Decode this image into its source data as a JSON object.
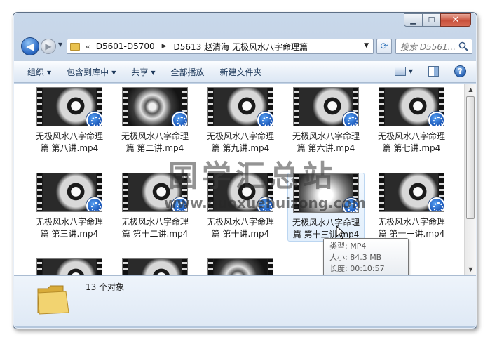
{
  "window": {
    "caption": {
      "minimize": "▁",
      "maximize": "☐",
      "close": "✕"
    }
  },
  "nav": {
    "back_glyph": "◀",
    "forward_glyph": "▶",
    "breadcrumb": [
      "D5601-D5700",
      "D5613 赵清海 无极风水八字命理篇"
    ],
    "breadcrumb_overflow": "«",
    "search_placeholder": "搜索 D5561..."
  },
  "toolbar": {
    "items": [
      "组织",
      "包含到库中",
      "共享",
      "全部播放",
      "新建文件夹"
    ],
    "has_dropdown": [
      true,
      true,
      true,
      false,
      false
    ]
  },
  "files": [
    {
      "name": "无极风水八字命理篇  第八讲.mp4",
      "thumb": "v1"
    },
    {
      "name": "无极风水八字命理篇  第二讲.mp4",
      "thumb": "v2"
    },
    {
      "name": "无极风水八字命理篇  第九讲.mp4",
      "thumb": "v1"
    },
    {
      "name": "无极风水八字命理篇  第六讲.mp4",
      "thumb": "v1"
    },
    {
      "name": "无极风水八字命理篇  第七讲.mp4",
      "thumb": "v1"
    },
    {
      "name": "无极风水八字命理篇  第三讲.mp4",
      "thumb": "v1"
    },
    {
      "name": "无极风水八字命理篇  第十二讲.mp4",
      "thumb": "v1"
    },
    {
      "name": "无极风水八字命理篇  第十讲.mp4",
      "thumb": "v1"
    },
    {
      "name": "无极风水八字命理篇  第十三讲.mp4",
      "thumb": "v3"
    },
    {
      "name": "无极风水八字命理篇  第十一讲.mp4",
      "thumb": "v1"
    },
    {
      "name": "",
      "thumb": "v1"
    },
    {
      "name": "",
      "thumb": "v1"
    },
    {
      "name": "",
      "thumb": "v2"
    }
  ],
  "tooltip": {
    "type": "类型: MP4",
    "size": "大小: 84.3 MB",
    "duration": "长度: 00:10:57"
  },
  "watermark": {
    "cn": "国学汇总站",
    "url": "www.guoxuehuizong.com"
  },
  "details": {
    "count_text": "13 个对象"
  },
  "colors": {
    "accent": "#2c66b8",
    "folder": "#e9c24f"
  }
}
